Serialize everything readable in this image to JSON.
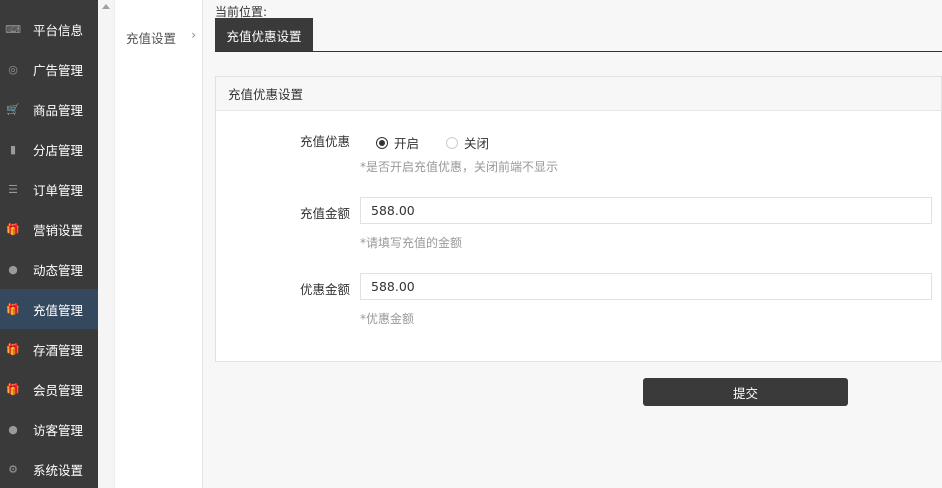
{
  "sidebar": {
    "items": [
      {
        "label": "平台信息",
        "icon": "keyboard-icon",
        "glyph": "⌨",
        "active": false
      },
      {
        "label": "广告管理",
        "icon": "support-icon",
        "glyph": "◎",
        "active": false
      },
      {
        "label": "商品管理",
        "icon": "cart-icon",
        "glyph": "🛒",
        "active": false
      },
      {
        "label": "分店管理",
        "icon": "book-icon",
        "glyph": "▮",
        "active": false
      },
      {
        "label": "订单管理",
        "icon": "list-icon",
        "glyph": "☰",
        "active": false
      },
      {
        "label": "营销设置",
        "icon": "gift-icon",
        "glyph": "🎁",
        "active": false
      },
      {
        "label": "动态管理",
        "icon": "user-icon",
        "glyph": "●",
        "active": false
      },
      {
        "label": "充值管理",
        "icon": "gift-icon",
        "glyph": "🎁",
        "active": true
      },
      {
        "label": "存酒管理",
        "icon": "gift-icon",
        "glyph": "🎁",
        "active": false
      },
      {
        "label": "会员管理",
        "icon": "gift-icon",
        "glyph": "🎁",
        "active": false
      },
      {
        "label": "访客管理",
        "icon": "user-icon",
        "glyph": "●",
        "active": false
      },
      {
        "label": "系统设置",
        "icon": "gear-icon",
        "glyph": "⚙",
        "active": false
      }
    ]
  },
  "submenu": {
    "item_label": "充值设置",
    "chevron": "›"
  },
  "breadcrumb": "当前位置:",
  "tab": {
    "label": "充值优惠设置"
  },
  "panel": {
    "title": "充值优惠设置",
    "discount": {
      "label": "充值优惠",
      "option_on": "开启",
      "option_off": "关闭",
      "selected": "开启",
      "hint": "*是否开启充值优惠，关闭前端不显示"
    },
    "amount": {
      "label": "充值金额",
      "value": "588.00",
      "hint": "*请填写充值的金额"
    },
    "bonus": {
      "label": "优惠金额",
      "value": "588.00",
      "hint": "*优惠金额"
    }
  },
  "submit_label": "提交"
}
